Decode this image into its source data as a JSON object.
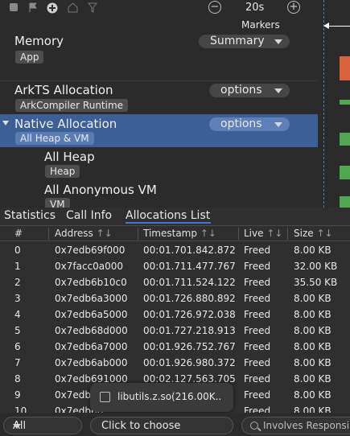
{
  "toolbar": {
    "icons": [
      "record-icon",
      "flag-icon",
      "add-circle-icon",
      "home-icon",
      "filter-icon"
    ],
    "zoom_minus": "−",
    "zoom_value": "20s",
    "zoom_plus": "+"
  },
  "markers_label": "Markers",
  "tracks": [
    {
      "title": "Memory",
      "tag": "App",
      "dropdown": "Summary"
    },
    {
      "title": "ArkTS Allocation",
      "tag": "ArkCompiler Runtime",
      "dropdown": "options"
    },
    {
      "title": "Native Allocation",
      "tag": "All Heap & VM",
      "dropdown": "options"
    },
    {
      "title": "All Heap",
      "tag": "Heap"
    },
    {
      "title": "All Anonymous VM",
      "tag": "VM"
    }
  ],
  "track_colors": {
    "memory": "#d8623b",
    "native": "#4fa84f",
    "selected": "#3c5f97"
  },
  "tabs": [
    "Statistics",
    "Call Info",
    "Allocations List"
  ],
  "active_tab": "Allocations List",
  "table": {
    "columns": [
      "#",
      "Address",
      "Timestamp",
      "Live",
      "Size"
    ],
    "sort_icon": "↑↓",
    "rows": [
      [
        "0",
        "0x7edb69f000",
        "00:01.701.842.872",
        "Freed",
        "8.00 KB"
      ],
      [
        "1",
        "0x7facc0a000",
        "00:01.711.477.767",
        "Freed",
        "32.00 KB"
      ],
      [
        "2",
        "0x7edb6b10c0",
        "00:01.711.524.122",
        "Freed",
        "35.50 KB"
      ],
      [
        "3",
        "0x7edb6a3000",
        "00:01.726.880.892",
        "Freed",
        "8.00 KB"
      ],
      [
        "4",
        "0x7edb6a5000",
        "00:01.726.972.038",
        "Freed",
        "8.00 KB"
      ],
      [
        "5",
        "0x7edb68d000",
        "00:01.727.218.913",
        "Freed",
        "8.00 KB"
      ],
      [
        "6",
        "0x7edb6a7000",
        "00:01.926.752.767",
        "Freed",
        "8.00 KB"
      ],
      [
        "7",
        "0x7edb6ab000",
        "00:01.926.980.372",
        "Freed",
        "8.00 KB"
      ],
      [
        "8",
        "0x7edb691000",
        "00:02.127.563.705",
        "Freed",
        "8.00 KB"
      ],
      [
        "9",
        "0x7edb6",
        "",
        "Freed",
        "8.00 KB"
      ],
      [
        "10",
        "0x7edb6b",
        "",
        "Freed",
        "8.00 KB"
      ]
    ]
  },
  "tooltip": {
    "label": "libutils.z.so(216.00K.."
  },
  "footer": {
    "select_value": "All",
    "choose_label": "Click to choose",
    "search_placeholder": "Involves Responsi"
  }
}
